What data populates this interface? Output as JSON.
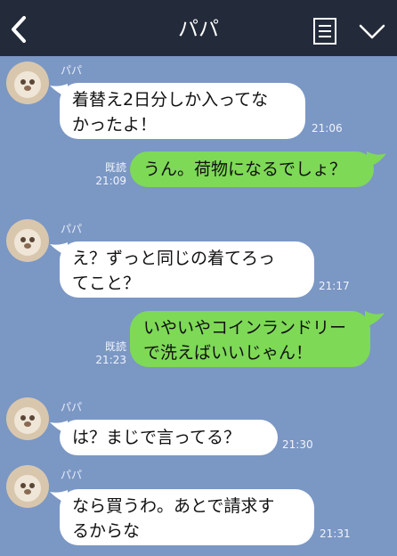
{
  "header": {
    "title": "パパ"
  },
  "colors": {
    "background": "#7b97c4",
    "header": "#232b3a",
    "incoming": "#ffffff",
    "outgoing": "#7ed957"
  },
  "messages": [
    {
      "sender": "パパ",
      "lines": [
        "着替え2日分しか入ってな",
        "かったよ！"
      ],
      "time": "21:06"
    },
    {
      "lines": [
        "うん。荷物になるでしょ？"
      ],
      "read": "既読",
      "time": "21:09"
    },
    {
      "sender": "パパ",
      "lines": [
        "え？ずっと同じの着てろっ",
        "てこと？"
      ],
      "time": "21:17"
    },
    {
      "lines": [
        "いやいやコインランドリー",
        "で洗えばいいじゃん！"
      ],
      "read": "既読",
      "time": "21:23"
    },
    {
      "sender": "パパ",
      "lines": [
        "は？まじで言ってる？"
      ],
      "time": "21:30"
    },
    {
      "sender": "パパ",
      "lines": [
        "なら買うわ。あとで請求す",
        "るからな"
      ],
      "time": "21:31"
    }
  ]
}
